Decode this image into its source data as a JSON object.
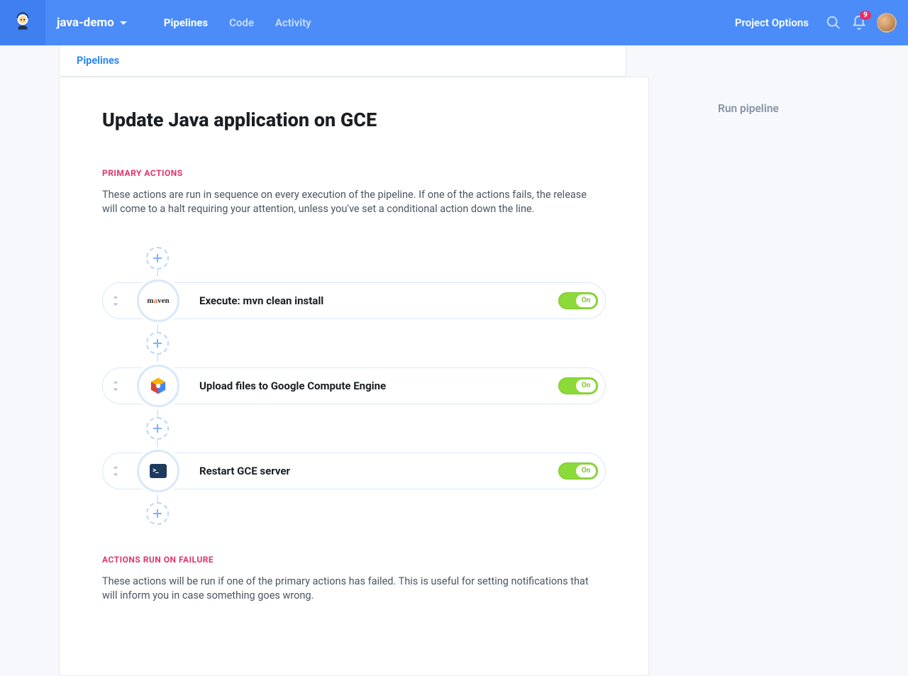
{
  "header": {
    "project_name": "java-demo",
    "nav": {
      "pipelines": "Pipelines",
      "code": "Code",
      "activity": "Activity"
    },
    "project_options": "Project Options",
    "notification_count": "9"
  },
  "tabs": {
    "pipelines": "Pipelines"
  },
  "title": "Update Java application on GCE",
  "primary": {
    "label": "PRIMARY ACTIONS",
    "desc": "These actions are run in sequence on every execution of the pipeline. If one of the actions fails, the release will come to a halt requiring your attention, unless you've set a conditional action down the line."
  },
  "actions": [
    {
      "title": "Execute: mvn clean install",
      "toggle": "On"
    },
    {
      "title": "Upload files to Google Compute Engine",
      "toggle": "On"
    },
    {
      "title": "Restart GCE server",
      "toggle": "On"
    }
  ],
  "failure": {
    "label": "ACTIONS RUN ON FAILURE",
    "desc": "These actions will be run if one of the primary actions has failed. This is useful for setting notifications that will inform you in case something goes wrong."
  },
  "sidebar": {
    "run_pipeline": "Run pipeline"
  }
}
